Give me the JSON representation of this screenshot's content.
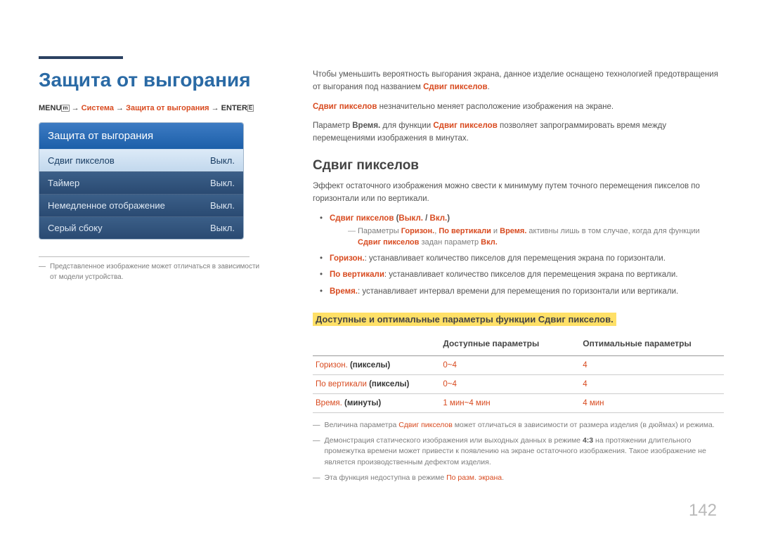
{
  "title": "Защита от выгорания",
  "breadcrumb": {
    "menu": "MENU",
    "sys": "Система",
    "scr": "Защита от выгорания",
    "enter": "ENTER"
  },
  "panel": {
    "header": "Защита от выгорания",
    "rows": [
      {
        "label": "Сдвиг пикселов",
        "value": "Выкл."
      },
      {
        "label": "Таймер",
        "value": "Выкл."
      },
      {
        "label": "Немедленное отображение",
        "value": "Выкл."
      },
      {
        "label": "Серый сбоку",
        "value": "Выкл."
      }
    ]
  },
  "left_footnote": "Представленное изображение может отличаться в зависимости от модели устройства.",
  "intro": {
    "p1a": "Чтобы уменьшить вероятность выгорания экрана, данное изделие оснащено технологией предотвращения от выгорания под названием ",
    "p1b": "Сдвиг пикселов",
    "p1c": ".",
    "p2a": "Сдвиг пикселов",
    "p2b": " незначительно меняет расположение изображения на экране.",
    "p3a": "Параметр ",
    "p3b": "Время.",
    "p3c": " для функции ",
    "p3d": "Сдвиг пикселов",
    "p3e": " позволяет запрограммировать время между перемещениями изображения в минутах."
  },
  "section_title": "Сдвиг пикселов",
  "section_desc": "Эффект остаточного изображения можно свести к минимуму путем точного перемещения пикселов по горизонтали или по вертикали.",
  "bullets": {
    "b1a": "Сдвиг пикселов",
    "b1b": " (",
    "b1c": "Выкл.",
    "b1d": " / ",
    "b1e": "Вкл.",
    "b1f": ")",
    "note1a": "Параметры ",
    "note1b": "Горизон.",
    "note1c": ", ",
    "note1d": "По вертикали",
    "note1e": " и ",
    "note1f": "Время.",
    "note1g": " активны лишь в том случае, когда для функции ",
    "note1h": "Сдвиг пикселов",
    "note1i": " задан параметр ",
    "note1j": "Вкл.",
    "b2a": "Горизон.",
    "b2b": ": устанавливает количество пикселов для перемещения экрана по горизонтали.",
    "b3a": "По вертикали",
    "b3b": ": устанавливает количество пикселов для перемещения экрана по вертикали.",
    "b4a": "Время.",
    "b4b": ": устанавливает интервал времени для перемещения по горизонтали или вертикали."
  },
  "sub_heading": "Доступные и оптимальные параметры функции Сдвиг пикселов.",
  "table": {
    "h1": "",
    "h2": "Доступные параметры",
    "h3": "Оптимальные параметры",
    "rows": [
      {
        "a1": "Горизон.",
        "a2": " (пикселы)",
        "b": "0~4",
        "c": "4"
      },
      {
        "a1": "По вертикали",
        "a2": " (пикселы)",
        "b": "0~4",
        "c": "4"
      },
      {
        "a1": "Время.",
        "a2": " (минуты)",
        "b": "1 мин~4 мин",
        "c": "4 мин"
      }
    ]
  },
  "notes": {
    "n1a": "Величина параметра ",
    "n1b": "Сдвиг пикселов",
    "n1c": " может отличаться в зависимости от размера изделия (в дюймах) и режима.",
    "n2a": "Демонстрация статического изображения или выходных данных в режиме ",
    "n2b": "4:3",
    "n2c": " на протяжении длительного промежутка времени может привести к появлению на экране остаточного изображения. Такое изображение не является производственным дефектом изделия.",
    "n3a": "Эта функция недоступна в режиме ",
    "n3b": "По разм. экрана",
    "n3c": "."
  },
  "page_number": "142"
}
